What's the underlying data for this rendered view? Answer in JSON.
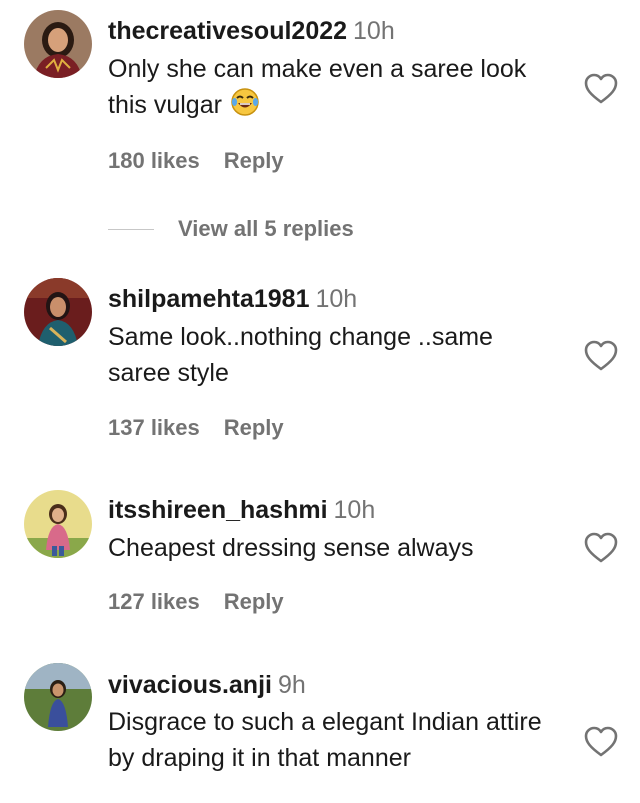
{
  "comments": [
    {
      "username": "thecreativesoul2022",
      "time": "10h",
      "text": "Only she can make even a saree look this vulgar",
      "emoji": "face-with-tears-of-joy",
      "likes": "180 likes",
      "reply_label": "Reply",
      "view_replies_label": "View all 5 replies",
      "avatar_colors": {
        "bg": "#9b7a62",
        "hair": "#2a1a12",
        "skin": "#d6a07a",
        "cloth": "#7a1f24"
      }
    },
    {
      "username": "shilpamehta1981",
      "time": "10h",
      "text": "Same look..nothing change ..same saree style",
      "likes": "137 likes",
      "reply_label": "Reply",
      "avatar_colors": {
        "bg": "#6a1d1d",
        "hair": "#221414",
        "skin": "#c98f6b",
        "cloth": "#1f5f6e"
      }
    },
    {
      "username": "itsshireen_hashmi",
      "time": "10h",
      "text": "Cheapest dressing sense always",
      "likes": "127 likes",
      "reply_label": "Reply",
      "avatar_colors": {
        "bg": "#e8dc8c",
        "hair": "#4a2e1a",
        "skin": "#e0b08a",
        "cloth": "#d86a8a"
      }
    },
    {
      "username": "vivacious.anji",
      "time": "9h",
      "text": "Disgrace to such a elegant Indian attire by draping it in that manner",
      "avatar_colors": {
        "bg": "#5e7d3a",
        "hair": "#2b1f14",
        "skin": "#c9946d",
        "cloth": "#3a4f9c"
      }
    }
  ],
  "colors": {
    "text": "#1a1a1a",
    "secondary": "#737373",
    "divider": "#c7c7c7",
    "heart_stroke": "#737373"
  },
  "icons": {
    "like": "heart-outline-icon",
    "emoji": "face-with-tears-of-joy-icon"
  }
}
